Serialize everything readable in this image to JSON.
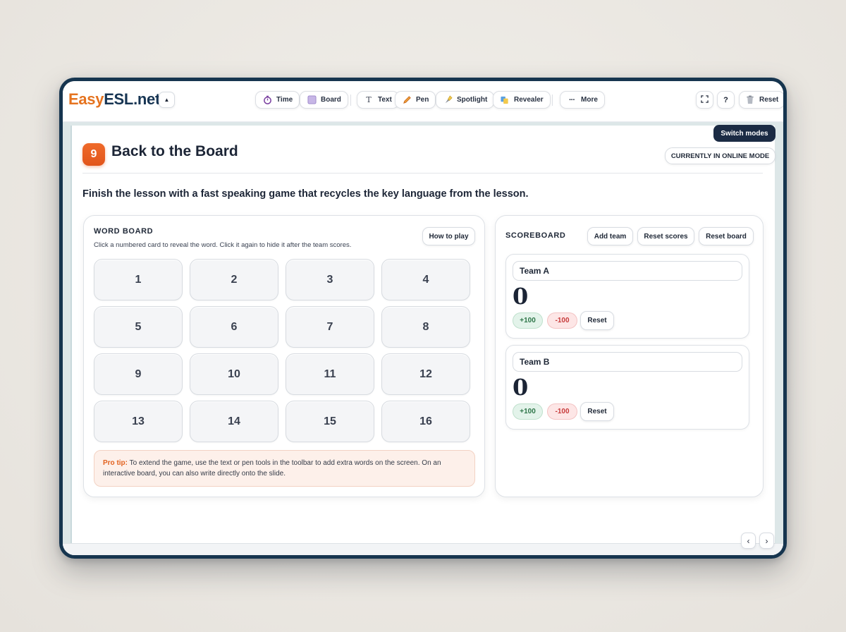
{
  "logo": {
    "part1": "Easy",
    "part2": "ESL.net"
  },
  "toolbar": {
    "collapse_icon": "▲",
    "tools": [
      {
        "label": "Time",
        "icon": "timer-icon"
      },
      {
        "label": "Board",
        "icon": "board-icon"
      },
      {
        "label": "Text",
        "icon": "text-icon"
      },
      {
        "label": "Pen",
        "icon": "pen-icon"
      },
      {
        "label": "Spotlight",
        "icon": "spotlight-icon"
      },
      {
        "label": "Revealer",
        "icon": "revealer-icon"
      },
      {
        "label": "More",
        "icon": "more-icon"
      }
    ],
    "fullscreen_icon": "⛶",
    "help_label": "?",
    "reset_label": "Reset"
  },
  "mode": {
    "switch_label": "Switch modes",
    "current_label": "CURRENTLY IN ONLINE MODE"
  },
  "slide": {
    "step_number": "9",
    "title": "Back to the Board",
    "subtitle": "Finish the lesson with a fast speaking game that recycles the key language from the lesson."
  },
  "word_board": {
    "heading": "WORD BOARD",
    "hint": "Click a numbered card to reveal the word. Click it again to hide it after the team scores.",
    "how_to_play": "How to play",
    "cards": [
      "1",
      "2",
      "3",
      "4",
      "5",
      "6",
      "7",
      "8",
      "9",
      "10",
      "11",
      "12",
      "13",
      "14",
      "15",
      "16"
    ],
    "pro_tip_label": "Pro tip:",
    "pro_tip_text": " To extend the game, use the text or pen tools in the toolbar to add extra words on the screen. On an interactive board, you can also write directly onto the slide."
  },
  "scoreboard": {
    "heading": "SCOREBOARD",
    "add_team": "Add team",
    "reset_scores": "Reset scores",
    "reset_board": "Reset board",
    "teams": [
      {
        "name": "Team A",
        "score": "0",
        "plus": "+100",
        "minus": "-100",
        "reset": "Reset"
      },
      {
        "name": "Team B",
        "score": "0",
        "plus": "+100",
        "minus": "-100",
        "reset": "Reset"
      }
    ]
  },
  "nav": {
    "prev": "‹",
    "next": "›"
  },
  "colors": {
    "accent": "#e5731f",
    "brand_dark": "#173553",
    "badge": "#e85f22"
  }
}
